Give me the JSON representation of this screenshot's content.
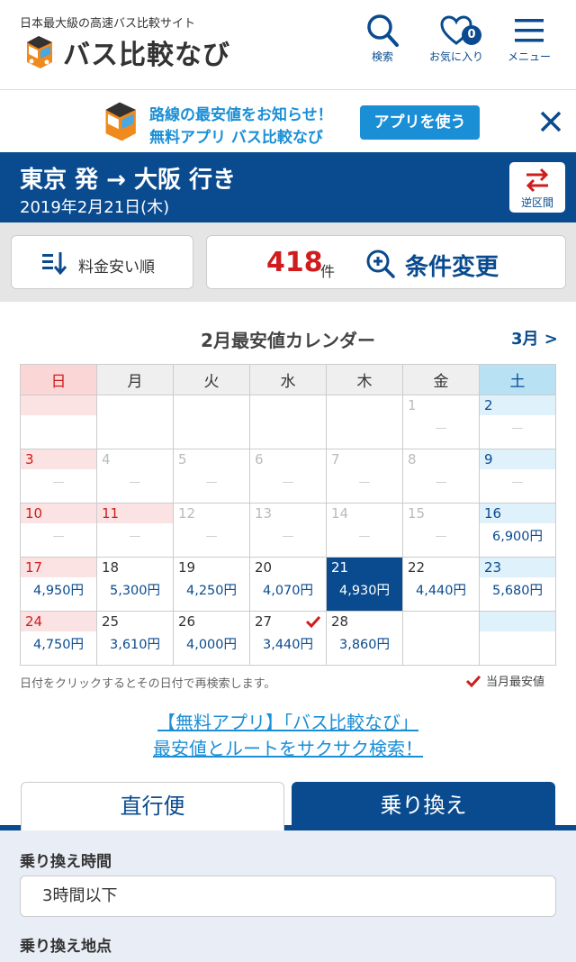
{
  "header": {
    "tagline": "日本最大級の高速バス比較サイト",
    "logo_text": "バス比較なび",
    "search_label": "検索",
    "favorites_label": "お気に入り",
    "favorites_count": "0",
    "menu_label": "メニュー"
  },
  "banner": {
    "line1": "路線の最安値をお知らせ！",
    "line2": "無料アプリ バス比較なび",
    "button_label": "アプリを使う"
  },
  "route": {
    "title": "東京 発 → 大阪 行き",
    "date": "2019年2月21日(木)",
    "reverse_label": "逆区間"
  },
  "toolbar": {
    "sort_label": "料金安い順",
    "count": "418",
    "count_unit": "件",
    "condition_label": "条件変更"
  },
  "calendar": {
    "title": "2月最安値カレンダー",
    "next_month": "3月 >",
    "weekdays": [
      "日",
      "月",
      "火",
      "水",
      "木",
      "金",
      "土"
    ],
    "dash": "—",
    "days": {
      "d1": "1",
      "d2": "2",
      "d3": "3",
      "d4": "4",
      "d5": "5",
      "d6": "6",
      "d7": "7",
      "d8": "8",
      "d9": "9",
      "d10": "10",
      "d11": "11",
      "d12": "12",
      "d13": "13",
      "d14": "14",
      "d15": "15",
      "d16": "16",
      "d17": "17",
      "d18": "18",
      "d19": "19",
      "d20": "20",
      "d21": "21",
      "d22": "22",
      "d23": "23",
      "d24": "24",
      "d25": "25",
      "d26": "26",
      "d27": "27",
      "d28": "28"
    },
    "prices": {
      "p16": "6,900円",
      "p17": "4,950円",
      "p18": "5,300円",
      "p19": "4,250円",
      "p20": "4,070円",
      "p21": "4,930円",
      "p22": "4,440円",
      "p23": "5,680円",
      "p24": "4,750円",
      "p25": "3,610円",
      "p26": "4,000円",
      "p27": "3,440円",
      "p28": "3,860円"
    },
    "note": "日付をクリックするとその日付で再検索します。",
    "legend": "当月最安値"
  },
  "promo": {
    "line1": "【無料アプリ】「バス比較なび」",
    "line2": "最安値とルートをサクサク検索！"
  },
  "tabs": {
    "direct": "直行便",
    "transfer": "乗り換え"
  },
  "transfer": {
    "time_label": "乗り換え時間",
    "time_value": "3時間以下",
    "place_label": "乗り換え地点"
  },
  "colors": {
    "brand_blue": "#0a4b8f",
    "accent_blue": "#1a8fd6",
    "price_red": "#d01c1c"
  }
}
